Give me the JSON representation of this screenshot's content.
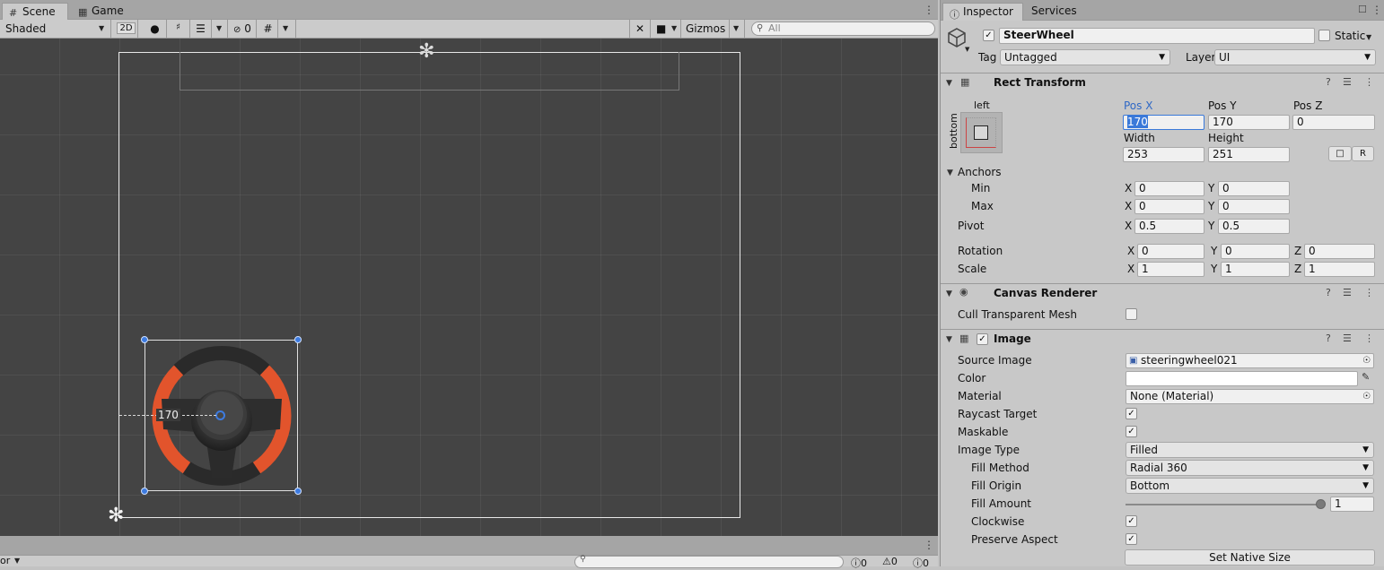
{
  "scene_tabs": {
    "scene": "Scene",
    "game": "Game"
  },
  "scene_toolbar": {
    "draw_mode": "Shaded",
    "mode_2d": "2D",
    "hidden_count": "0",
    "gizmos": "Gizmos",
    "search_placeholder": "All"
  },
  "viewport": {
    "measure_label": "170"
  },
  "console": {
    "partial_label": "or",
    "log_count": "0",
    "warning_count": "0",
    "error_count": "0"
  },
  "inspector_tabs": {
    "inspector": "Inspector",
    "services": "Services"
  },
  "object": {
    "name": "SteerWheel",
    "active": true,
    "static_label": "Static",
    "tag_label": "Tag",
    "tag_value": "Untagged",
    "layer_label": "Layer",
    "layer_value": "UI"
  },
  "rect_transform": {
    "title": "Rect Transform",
    "anchor_h": "left",
    "anchor_v": "bottom",
    "pos_x_label": "Pos X",
    "pos_y_label": "Pos Y",
    "pos_z_label": "Pos Z",
    "pos_x": "170",
    "pos_y": "170",
    "pos_z": "0",
    "width_label": "Width",
    "height_label": "Height",
    "width": "253",
    "height": "251",
    "r_button": "R",
    "anchors_label": "Anchors",
    "min_label": "Min",
    "max_label": "Max",
    "pivot_label": "Pivot",
    "x_label": "X",
    "y_label": "Y",
    "z_label": "Z",
    "min_x": "0",
    "min_y": "0",
    "max_x": "0",
    "max_y": "0",
    "pivot_x": "0.5",
    "pivot_y": "0.5",
    "rotation_label": "Rotation",
    "rot_x": "0",
    "rot_y": "0",
    "rot_z": "0",
    "scale_label": "Scale",
    "scale_x": "1",
    "scale_y": "1",
    "scale_z": "1"
  },
  "canvas_renderer": {
    "title": "Canvas Renderer",
    "cull_label": "Cull Transparent Mesh",
    "cull_value": false
  },
  "image": {
    "title": "Image",
    "enabled": true,
    "source_label": "Source Image",
    "source_value": "steeringwheel021",
    "color_label": "Color",
    "color_value": "#ffffff",
    "material_label": "Material",
    "material_value": "None (Material)",
    "raycast_label": "Raycast Target",
    "raycast_value": true,
    "maskable_label": "Maskable",
    "maskable_value": true,
    "image_type_label": "Image Type",
    "image_type_value": "Filled",
    "fill_method_label": "Fill Method",
    "fill_method_value": "Radial 360",
    "fill_origin_label": "Fill Origin",
    "fill_origin_value": "Bottom",
    "fill_amount_label": "Fill Amount",
    "fill_amount_value": "1",
    "clockwise_label": "Clockwise",
    "clockwise_value": true,
    "preserve_label": "Preserve Aspect",
    "preserve_value": true,
    "native_size_button": "Set Native Size"
  },
  "colors": {
    "accent_blue": "#2f68c5",
    "wheel_orange": "#e2542c",
    "wheel_dark": "#2a2a2a",
    "viewport_bg": "#444444"
  }
}
